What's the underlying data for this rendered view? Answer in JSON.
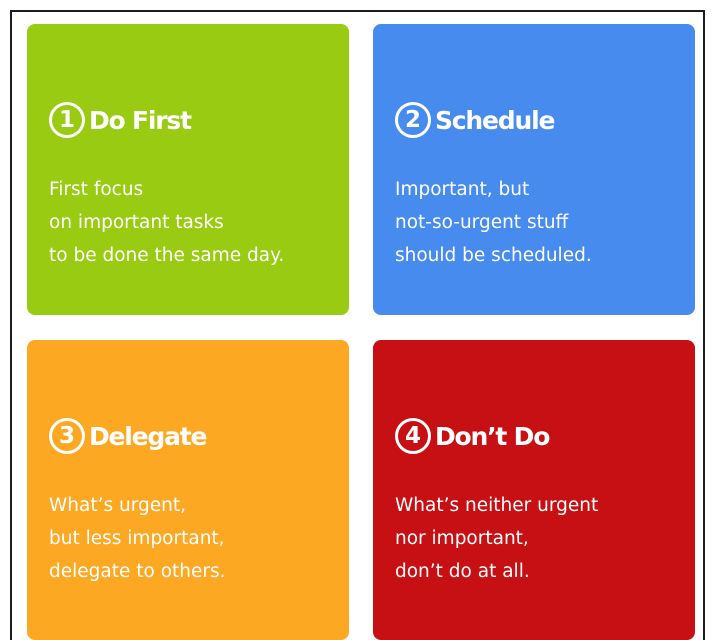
{
  "quadrants": [
    {
      "number": "1",
      "title": "Do First",
      "lines": [
        "First focus",
        "on important tasks",
        "to be done the same day."
      ],
      "color": "#98cb11"
    },
    {
      "number": "2",
      "title": "Schedule",
      "lines": [
        "Important, but",
        "not-so-urgent stuff",
        "should be scheduled."
      ],
      "color": "#468bed"
    },
    {
      "number": "3",
      "title": "Delegate",
      "lines": [
        "What’s urgent,",
        "but less important,",
        "delegate to others."
      ],
      "color": "#fda822"
    },
    {
      "number": "4",
      "title": "Don’t Do",
      "lines": [
        "What’s neither urgent",
        "nor important,",
        "don’t do at all."
      ],
      "color": "#c71013"
    }
  ]
}
